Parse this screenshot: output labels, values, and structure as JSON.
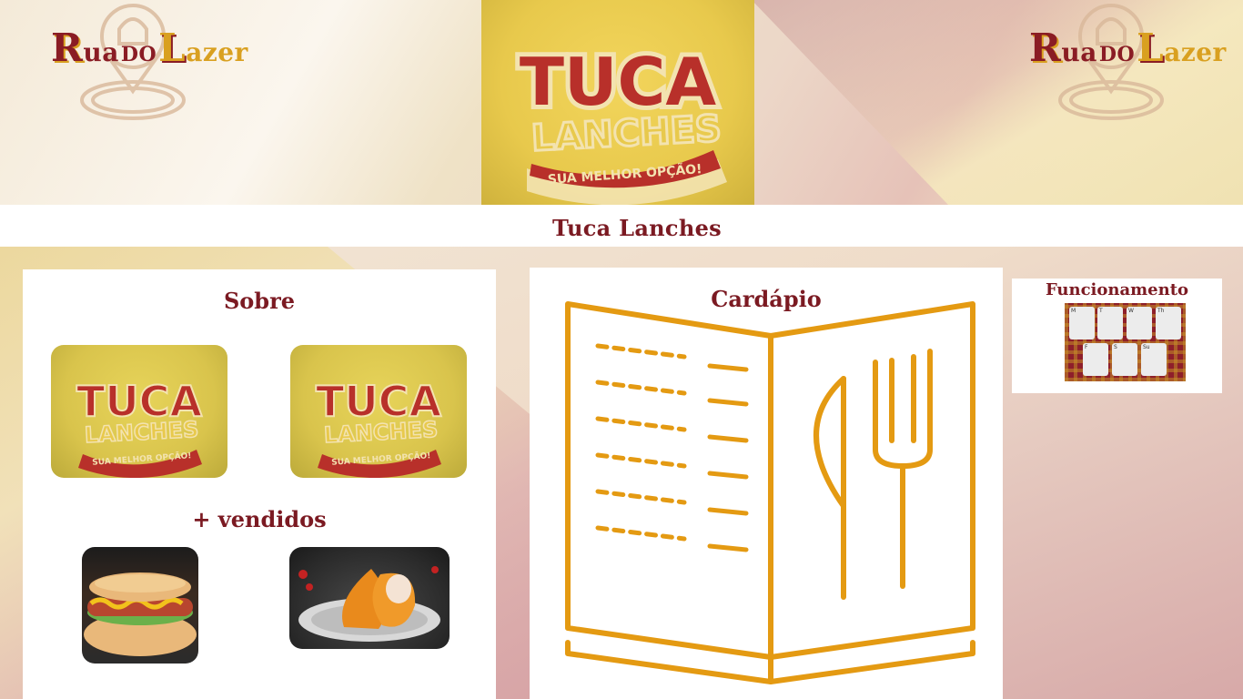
{
  "header": {
    "logo_left": {
      "r": "R",
      "ua": "ua",
      "do": "DO",
      "l": "L",
      "azer": "azer"
    },
    "logo_right": {
      "r": "R",
      "ua": "ua",
      "do": "DO",
      "l": "L",
      "azer": "azer"
    },
    "banner": {
      "title": "TUCA",
      "subtitle": "LANCHES",
      "tagline": "SUA MELHOR OPÇÃO!"
    }
  },
  "page_title": "Tuca Lanches",
  "sobre": {
    "title": "Sobre",
    "images": [
      {
        "title": "TUCA",
        "subtitle": "LANCHES",
        "tagline": "SUA MELHOR OPÇÃO!"
      },
      {
        "title": "TUCA",
        "subtitle": "LANCHES",
        "tagline": "SUA MELHOR OPÇÃO!"
      }
    ]
  },
  "mais_vendidos": {
    "title": "+ vendidos",
    "items": [
      {
        "icon": "hotdog-image"
      },
      {
        "icon": "coxinha-image"
      }
    ]
  },
  "cardapio": {
    "title": "Cardápio",
    "icon": "menu-book-icon"
  },
  "funcionamento": {
    "title": "Funcionamento",
    "days": [
      "M",
      "T",
      "W",
      "Th",
      "",
      "F",
      "S",
      "Su"
    ]
  },
  "colors": {
    "brand_red": "#7b1a22",
    "accent_gold": "#e49a12",
    "banner_yellow": "#e8c94c"
  }
}
